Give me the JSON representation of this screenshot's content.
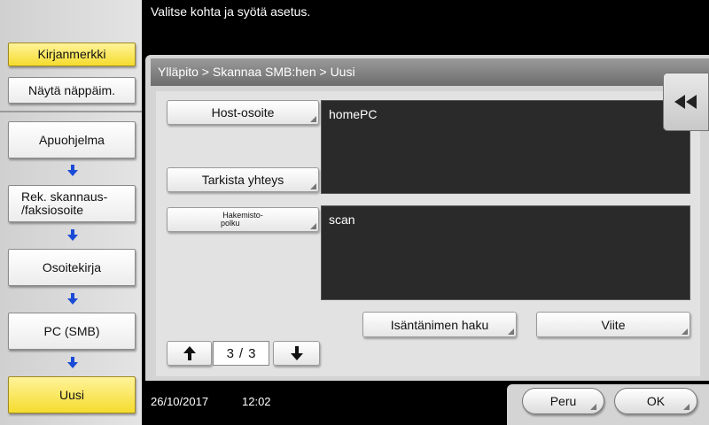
{
  "header": {
    "instruction": "Valitse kohta ja syötä asetus."
  },
  "sidebar": {
    "bookmark_label": "Kirjanmerkki",
    "show_keypad_label": "Näytä näppäim.",
    "flow": [
      {
        "label": "Apuohjelma"
      },
      {
        "label": "Rek. skannaus-\n/faksiosoite"
      },
      {
        "label": "Osoitekirja"
      },
      {
        "label": "PC (SMB)"
      },
      {
        "label": "Uusi"
      }
    ]
  },
  "breadcrumb": "Ylläpito > Skannaa SMB:hen > Uusi",
  "form": {
    "host_label": "Host-osoite",
    "host_value": "homePC",
    "check_label": "Tarkista yhteys",
    "path_label_line1": "Hakemisto-",
    "path_label_line2": "polku",
    "path_value": "scan",
    "host_search_label": "Isäntänimen haku",
    "reference_label": "Viite"
  },
  "pager": {
    "current": "3",
    "separator": "/",
    "total": "3"
  },
  "status": {
    "date": "26/10/2017",
    "time": "12:02"
  },
  "footer": {
    "cancel_label": "Peru",
    "ok_label": "OK"
  },
  "colors": {
    "accent_yellow": "#f5dc2e",
    "arrow_blue": "#1a4bd6",
    "field_bg": "#2a2a2a"
  },
  "icons": {
    "back": "rewind-icon",
    "up": "arrow-up-icon",
    "down": "arrow-down-icon",
    "flow": "arrow-down-blue-icon"
  }
}
